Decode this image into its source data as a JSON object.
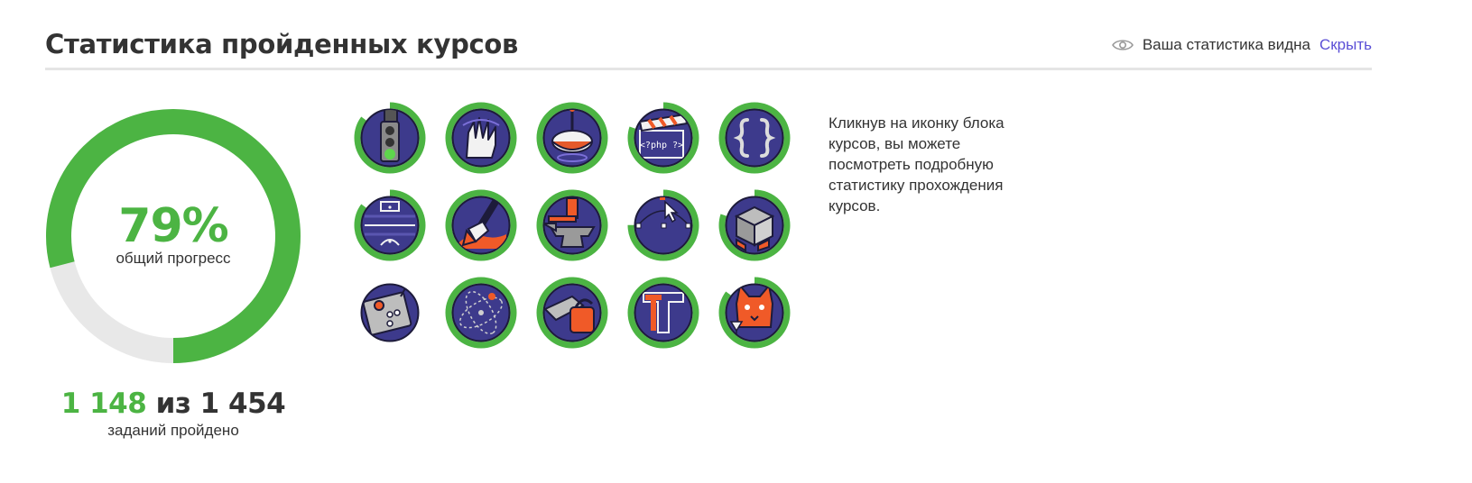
{
  "header": {
    "title": "Статистика пройденных курсов",
    "visibility_text": "Ваша статистика видна",
    "hide_label": "Скрыть",
    "icon": "eye-icon"
  },
  "progress": {
    "percent_text": "79%",
    "fraction": 0.79,
    "caption": "общий прогресс",
    "color": "#4cb443",
    "track_color": "#e8e8e8"
  },
  "tasks": {
    "done": "1 148",
    "separator": "из",
    "total": "1 454",
    "caption": "заданий пройдено"
  },
  "courses": [
    {
      "icon": "traffic-light-icon",
      "progress": 0.85
    },
    {
      "icon": "vulcan-hand-icon",
      "progress": 1.0
    },
    {
      "icon": "spinning-top-icon",
      "progress": 1.0
    },
    {
      "icon": "php-clapperboard-icon",
      "progress": 0.8
    },
    {
      "icon": "curly-braces-icon",
      "progress": 1.0
    },
    {
      "icon": "football-field-icon",
      "progress": 0.85
    },
    {
      "icon": "paint-brush-icon",
      "progress": 1.0
    },
    {
      "icon": "anvil-icon",
      "progress": 1.0
    },
    {
      "icon": "vector-cursor-icon",
      "progress": 0.75
    },
    {
      "icon": "rubiks-cube-icon",
      "progress": 0.8
    },
    {
      "icon": "remote-control-icon",
      "progress": 0.0
    },
    {
      "icon": "orbit-icon",
      "progress": 1.0
    },
    {
      "icon": "chainsaw-icon",
      "progress": 1.0
    },
    {
      "icon": "letter-t-icon",
      "progress": 1.0
    },
    {
      "icon": "cat-cocktail-icon",
      "progress": 0.85
    }
  ],
  "hint": "Кликнув на иконку блока курсов, вы можете посмотреть подробную статистику прохождения курсов.",
  "colors": {
    "accent": "#4cb443",
    "link": "#5b4fd6",
    "icon_bg": "#3d3a8c",
    "icon_outline": "#1d1b3a",
    "icon_orange": "#f05a28"
  }
}
